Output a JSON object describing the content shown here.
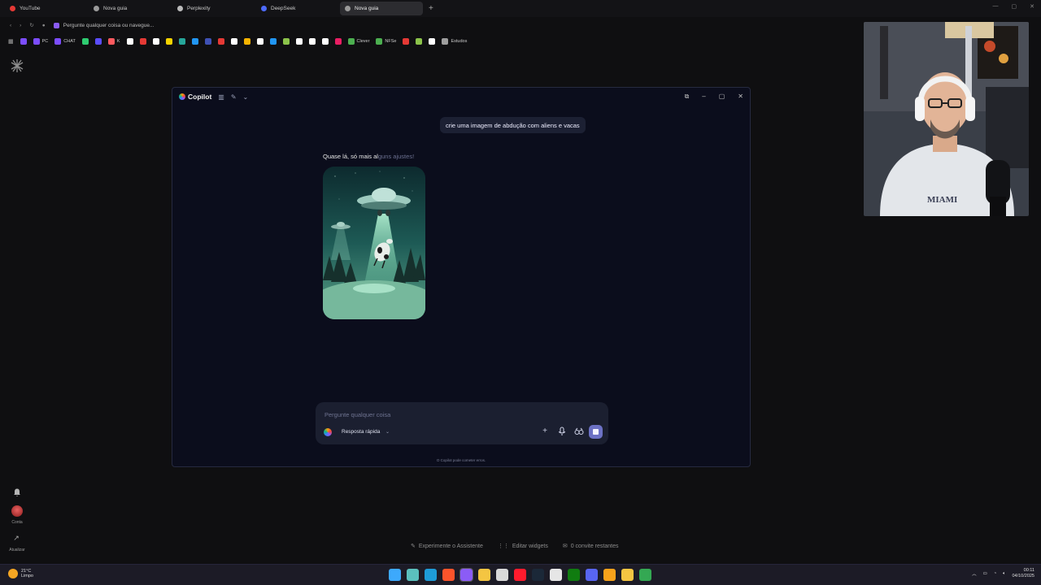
{
  "browser": {
    "tabs": [
      {
        "label": "YouTube",
        "color": "#e53935",
        "active": false
      },
      {
        "label": "Nova guia",
        "color": "#9a9a9a",
        "active": false
      },
      {
        "label": "Perplexity",
        "color": "#bbbbbb",
        "active": false
      },
      {
        "label": "DeepSeek",
        "color": "#4d6bfe",
        "active": false
      },
      {
        "label": "Nova guia",
        "color": "#9a9a9a",
        "active": true
      }
    ],
    "address_placeholder": "Pergunte qualquer coisa ou navegue...",
    "bookmarks": [
      {
        "label": "",
        "color": "#7c4dff"
      },
      {
        "label": "PC",
        "color": "#7c4dff"
      },
      {
        "label": "CHAT",
        "color": "#7c4dff"
      },
      {
        "label": "",
        "color": "#2ecc71"
      },
      {
        "label": "",
        "color": "#5b4dff"
      },
      {
        "label": "K",
        "color": "#ff5a5f"
      },
      {
        "label": "",
        "color": "#ffffff"
      },
      {
        "label": "",
        "color": "#e53935"
      },
      {
        "label": "",
        "color": "#ffffff"
      },
      {
        "label": "",
        "color": "#f5d300"
      },
      {
        "label": "",
        "color": "#26a69a"
      },
      {
        "label": "",
        "color": "#2196f3"
      },
      {
        "label": "",
        "color": "#3f51b5"
      },
      {
        "label": "",
        "color": "#e53935"
      },
      {
        "label": "",
        "color": "#ffffff"
      },
      {
        "label": "",
        "color": "#f5b300"
      },
      {
        "label": "",
        "color": "#ffffff"
      },
      {
        "label": "",
        "color": "#2196f3"
      },
      {
        "label": "",
        "color": "#8bc34a"
      },
      {
        "label": "",
        "color": "#ffffff"
      },
      {
        "label": "",
        "color": "#ffffff"
      },
      {
        "label": "",
        "color": "#ffffff"
      },
      {
        "label": "",
        "color": "#e91e63"
      },
      {
        "label": "Clever",
        "color": "#4caf50"
      },
      {
        "label": "NFSe",
        "color": "#4caf50"
      },
      {
        "label": "",
        "color": "#e53935"
      },
      {
        "label": "",
        "color": "#8bc34a"
      },
      {
        "label": "",
        "color": "#ffffff"
      },
      {
        "label": "Estudos",
        "color": "#9e9e9e"
      }
    ]
  },
  "rail": {
    "account_label": "Conta",
    "update_label": "Atualizar"
  },
  "copilot": {
    "title": "Copilot",
    "user_message": "crie uma imagem de abdução com aliens e vacas",
    "assistant_status_main": "Quase lá, só mais al",
    "assistant_status_fade": "guns ajustes!",
    "input_placeholder": "Pergunte qualquer coisa",
    "mode_label": "Resposta rápida",
    "disclaimer": "O Copilot pode cometer erros."
  },
  "widgets": {
    "assistant": "Experimente o Assistente",
    "edit": "Editar widgets",
    "invites": "0 convite restantes"
  },
  "taskbar": {
    "temperature": "21°C",
    "condition": "Limpo",
    "time": "00:11",
    "date": "04/10/2025",
    "apps": [
      "windows",
      "widgets",
      "edge",
      "brave",
      "copilot",
      "files",
      "notepad",
      "opera",
      "steam",
      "github",
      "xbox",
      "discord",
      "winamp",
      "folder",
      "chrome"
    ]
  }
}
